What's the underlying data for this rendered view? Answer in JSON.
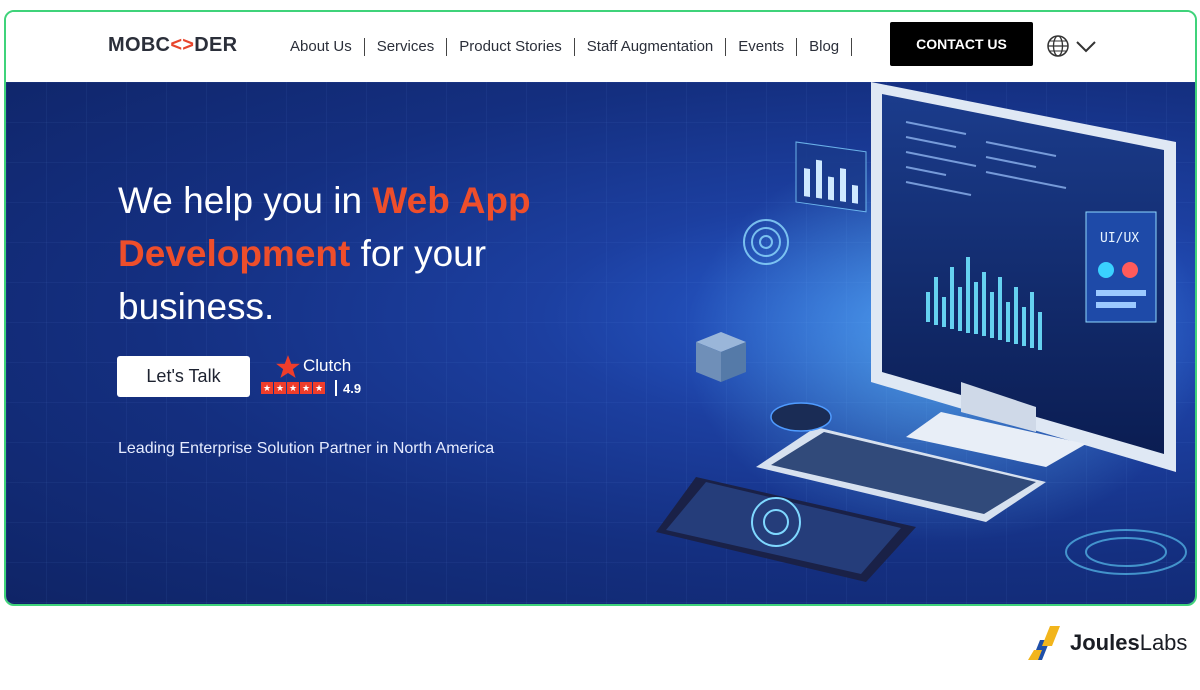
{
  "nav": {
    "logo_left": "MOBC",
    "logo_mark": "<>",
    "logo_right": "DER",
    "items": [
      {
        "label": "About Us"
      },
      {
        "label": "Services"
      },
      {
        "label": "Product Stories"
      },
      {
        "label": "Staff Augmentation"
      },
      {
        "label": "Events"
      },
      {
        "label": "Blog"
      }
    ],
    "contact_label": "CONTACT US",
    "language_icon": "globe-icon"
  },
  "hero": {
    "line1_plain": "We help you in ",
    "line1_highlight": "Web App",
    "line2_highlight": "Development",
    "line2_plain": " for your",
    "line3_plain": "business.",
    "cta_label": "Let's Talk",
    "clutch_name": "Clutch",
    "clutch_rating": "4.9",
    "tagline": "Leading Enterprise Solution Partner in North America",
    "art_screen_text": "UI/UX"
  },
  "brand": {
    "name_bold": "Joules",
    "name_regular": "Labs"
  },
  "colors": {
    "accent": "#ee4e2b",
    "hero_bg": "#142f80",
    "frame_border": "#3fd37a",
    "button_dark": "#000000"
  }
}
